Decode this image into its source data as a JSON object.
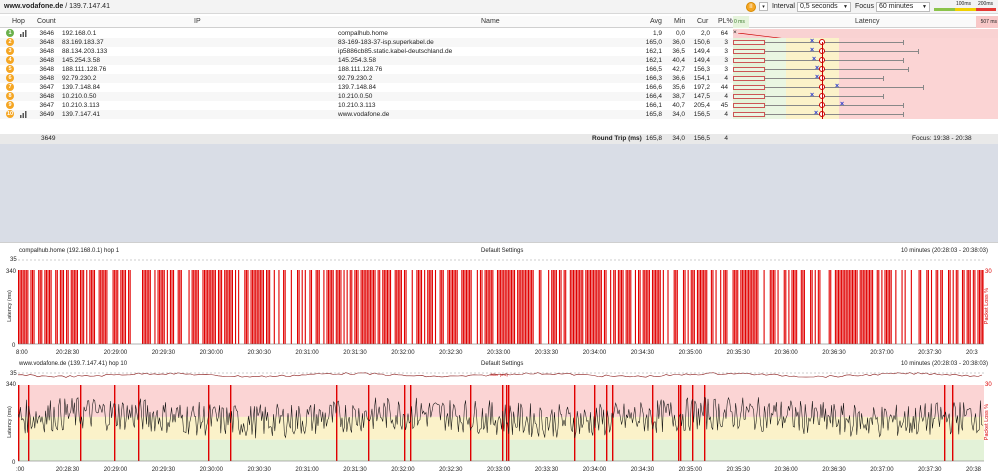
{
  "toolbar": {
    "target_host": "www.vodafone.de",
    "target_sep": " / ",
    "target_ip": "139.7.147.41",
    "pause_glyph": "II",
    "dropdown_glyph": "▾",
    "interval_label": "Interval",
    "interval_value": "0,5 seconds",
    "focus_label": "Focus",
    "focus_value": "60 minutes",
    "legend_100": "100ms",
    "legend_200": "200ms"
  },
  "columns": {
    "hop": "Hop",
    "count": "Count",
    "ip": "IP",
    "name": "Name",
    "avg": "Avg",
    "min": "Min",
    "cur": "Cur",
    "pl": "PL%",
    "latency": "Latency",
    "ms0": "0 ms",
    "ms507": "507 ms"
  },
  "hops": [
    {
      "hop": "1",
      "count": "3646",
      "ip": "192.168.0.1",
      "name": "compalhub.home",
      "avg": "1,9",
      "min": "0,0",
      "cur": "2,0",
      "pl": "64",
      "signal": true
    },
    {
      "hop": "2",
      "count": "3648",
      "ip": "83.169.183.37",
      "name": "83-169-183-37-isp.superkabel.de",
      "avg": "165,0",
      "min": "36,0",
      "cur": "150,6",
      "pl": "3",
      "signal": false
    },
    {
      "hop": "3",
      "count": "3648",
      "ip": "88.134.203.133",
      "name": "ip5886cb85.static.kabel-deutschland.de",
      "avg": "162,1",
      "min": "36,5",
      "cur": "149,4",
      "pl": "3",
      "signal": false
    },
    {
      "hop": "4",
      "count": "3648",
      "ip": "145.254.3.58",
      "name": "145.254.3.58",
      "avg": "162,1",
      "min": "40,4",
      "cur": "149,4",
      "pl": "3",
      "signal": false
    },
    {
      "hop": "5",
      "count": "3648",
      "ip": "188.111.128.76",
      "name": "188.111.128.76",
      "avg": "166,5",
      "min": "42,7",
      "cur": "156,3",
      "pl": "3",
      "signal": false
    },
    {
      "hop": "6",
      "count": "3648",
      "ip": "92.79.230.2",
      "name": "92.79.230.2",
      "avg": "166,3",
      "min": "36,6",
      "cur": "154,1",
      "pl": "4",
      "signal": false
    },
    {
      "hop": "7",
      "count": "3647",
      "ip": "139.7.148.84",
      "name": "139.7.148.84",
      "avg": "166,6",
      "min": "35,6",
      "cur": "197,2",
      "pl": "44",
      "signal": false
    },
    {
      "hop": "8",
      "count": "3648",
      "ip": "10.210.0.50",
      "name": "10.210.0.50",
      "avg": "166,4",
      "min": "38,7",
      "cur": "147,5",
      "pl": "4",
      "signal": false
    },
    {
      "hop": "9",
      "count": "3647",
      "ip": "10.210.3.113",
      "name": "10.210.3.113",
      "avg": "166,1",
      "min": "40,7",
      "cur": "205,4",
      "pl": "45",
      "signal": false
    },
    {
      "hop": "10",
      "count": "3649",
      "ip": "139.7.147.41",
      "name": "www.vodafone.de",
      "avg": "165,8",
      "min": "34,0",
      "cur": "156,5",
      "pl": "4",
      "signal": true
    }
  ],
  "summary": {
    "count": "3649",
    "label": "Round Trip (ms)",
    "avg": "165,8",
    "min": "34,0",
    "cur": "156,5",
    "pl": "4",
    "focus": "Focus: 19:38 - 20:38"
  },
  "chart1": {
    "title": "compalhub.home (192.168.0.1) hop 1",
    "settings": "Default Settings",
    "range": "10 minutes (20:28:03 - 20:38:03)",
    "y_top": "35",
    "y_max": "340",
    "y_zero": "0",
    "pl_top": "30",
    "ylabel": "Latency (ms)",
    "pl_label": "Packet Loss %",
    "jitter": "Jitter (ms)"
  },
  "chart2": {
    "title": "www.vodafone.de (139.7.147.41) hop 10",
    "settings": "Default Settings",
    "range": "10 minutes (20:28:03 - 20:38:03)",
    "y_top": "35",
    "y_max": "340",
    "y_zero": "0",
    "pl_top": "30",
    "ylabel": "Latency (ms)",
    "pl_label": "Packet Loss %",
    "jitter": "Jitter (ms)",
    "band_200": "200",
    "band_100": "100"
  },
  "xticks1": [
    "8:00",
    "20:28:30",
    "20:29:00",
    "20:29:30",
    "20:30:00",
    "20:30:30",
    "20:31:00",
    "20:31:30",
    "20:32:00",
    "20:32:30",
    "20:33:00",
    "20:33:30",
    "20:34:00",
    "20:34:30",
    "20:35:00",
    "20:35:30",
    "20:36:00",
    "20:36:30",
    "20:37:00",
    "20:37:30",
    "20:3"
  ],
  "xticks2": [
    ":00",
    "20:28:30",
    "20:29:00",
    "20:29:30",
    "20:30:00",
    "20:30:30",
    "20:31:00",
    "20:31:30",
    "20:32:00",
    "20:32:30",
    "20:33:00",
    "20:33:30",
    "20:34:00",
    "20:34:30",
    "20:35:00",
    "20:35:30",
    "20:36:00",
    "20:36:30",
    "20:37:00",
    "20:37:30",
    "20:38"
  ],
  "colors": {
    "accent_red": "#e00000",
    "green_zone": "#e3f2d8",
    "yellow_zone": "#fbf2c9",
    "red_zone": "#fbd4d4",
    "badge_green": "#6ab04c",
    "badge_orange": "#f5a623"
  },
  "icons": {
    "pause": "pause-icon",
    "signal": "signal-bars-icon",
    "dropdown": "chevron-down-icon"
  }
}
